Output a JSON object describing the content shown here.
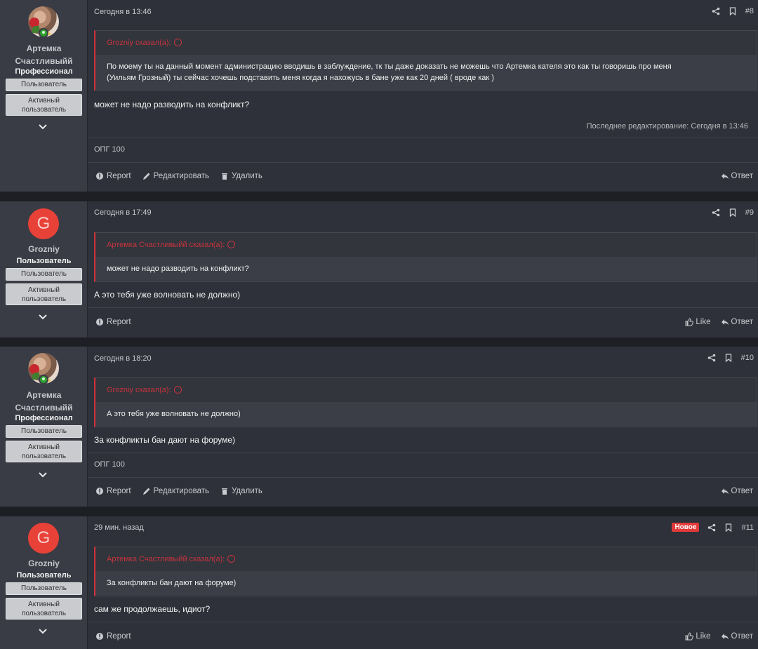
{
  "posts": [
    {
      "user": {
        "name_line1": "Артемка",
        "name_line2": "Счастливыйй",
        "title": "Профессионал",
        "badge1": "Пользователь",
        "badge2_line1": "Активный",
        "badge2_line2": "пользователь",
        "avatar": "photo"
      },
      "date": "Сегодня в 13:46",
      "number": "#8",
      "quote_author": "Grozniy сказал(а):",
      "quote_text_line1": "По моему ты на данный момент администрацию вводишь в заблуждение, тк ты даже доказать не можешь что Артемка кателя это как ты говоришь про меня",
      "quote_text_line2": "(Уильям Грозный) ты сейчас хочешь подставить меня когда я нахожусь в бане уже как 20 дней ( вроде как )",
      "message": "может не надо разводить на конфликт?",
      "edited": "Последнее редактирование: Сегодня в 13:46",
      "signature": "ОПГ 100",
      "actions": [
        "Report",
        "Редактировать",
        "Удалить"
      ],
      "reply": "Ответ"
    },
    {
      "user": {
        "name_line1": "Grozniy",
        "title": "Пользователь",
        "badge1": "Пользователь",
        "badge2_line1": "Активный",
        "badge2_line2": "пользователь",
        "avatar_letter": "G"
      },
      "date": "Сегодня в 17:49",
      "number": "#9",
      "quote_author": "Артемка Счастливыйй сказал(а):",
      "quote_text": "может не надо разводить на конфликт?",
      "message": "А это тебя уже волновать не должно)",
      "actions": [
        "Report"
      ],
      "like": "Like",
      "reply": "Ответ"
    },
    {
      "user": {
        "name_line1": "Артемка",
        "name_line2": "Счастливыйй",
        "title": "Профессионал",
        "badge1": "Пользователь",
        "badge2_line1": "Активный",
        "badge2_line2": "пользователь",
        "avatar": "photo"
      },
      "date": "Сегодня в 18:20",
      "number": "#10",
      "quote_author": "Grozniy сказал(а):",
      "quote_text": "А это тебя уже волновать не должно)",
      "message": "За конфликты бан дают на форуме)",
      "signature": "ОПГ 100",
      "actions": [
        "Report",
        "Редактировать",
        "Удалить"
      ],
      "reply": "Ответ"
    },
    {
      "user": {
        "name_line1": "Grozniy",
        "title": "Пользователь",
        "badge1": "Пользователь",
        "badge2_line1": "Активный",
        "badge2_line2": "пользователь",
        "avatar_letter": "G"
      },
      "date": "29 мин. назад",
      "new_label": "Новое",
      "number": "#11",
      "quote_author": "Артемка Счастливыйй сказал(а):",
      "quote_text": "За конфликты бан дают на форуме)",
      "message": "сам же продолжаешь, идиот?",
      "actions": [
        "Report"
      ],
      "like": "Like",
      "reply": "Ответ"
    }
  ],
  "colors": {
    "background": "#2e3139",
    "user_panel": "#393c45",
    "quote_accent": "#d3313a",
    "new_badge": "#e23a3a",
    "avatar_letter_bg": "#e84138"
  }
}
